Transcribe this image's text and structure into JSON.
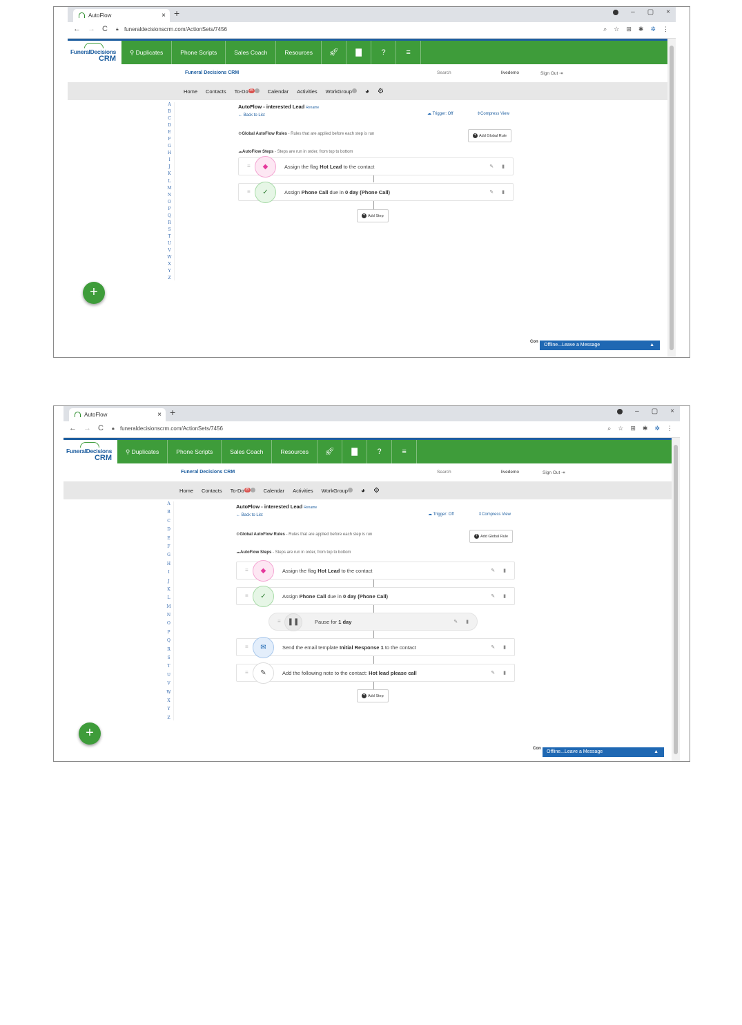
{
  "browser": {
    "tab_title": "AutoFlow",
    "tab_close": "×",
    "new_tab": "+",
    "url": "funeraldecisionscrm.com/ActionSets/7456",
    "back": "←",
    "forward": "→",
    "reload": "C",
    "minimize": "–",
    "restore": "▢",
    "close": "×"
  },
  "logo": {
    "top": "FuneralDecisions",
    "crm": "CRM"
  },
  "main_nav": {
    "duplicates": "Duplicates",
    "phone_scripts": "Phone Scripts",
    "sales_coach": "Sales Coach",
    "resources": "Resources"
  },
  "crm_bar": {
    "title": "Funeral Decisions CRM",
    "search": "Search",
    "user": "livedemo",
    "sign_out": "Sign Out"
  },
  "sub_nav": {
    "home": "Home",
    "contacts": "Contacts",
    "todo": "To-Do",
    "todo_badge": "35",
    "calendar": "Calendar",
    "activities": "Activities",
    "workgroup": "WorkGroup"
  },
  "alphabet": [
    "A",
    "B",
    "C",
    "D",
    "E",
    "F",
    "G",
    "H",
    "I",
    "J",
    "K",
    "L",
    "M",
    "N",
    "O",
    "P",
    "Q",
    "R",
    "S",
    "T",
    "U",
    "V",
    "W",
    "X",
    "Y",
    "Z"
  ],
  "fab": "+",
  "autoflow": {
    "title": "AutoFlow - interested Lead",
    "rename": "Rename",
    "back_to_list": "Back to List",
    "trigger": "Trigger: Off",
    "compress": "Compress View",
    "global_rules_label": "Global AutoFlow Rules",
    "global_rules_desc": " - Rules that are applied before each step is run",
    "add_global_rule": "Add Global Rule",
    "steps_label": "AutoFlow Steps",
    "steps_desc": " - Steps are run in order, from top to bottom",
    "add_step": "Add Step"
  },
  "steps_first": [
    {
      "pre": "Assign the flag ",
      "bold": "Hot Lead",
      "post": " to the contact"
    },
    {
      "pre": "Assign ",
      "bold": "Phone Call",
      "post": " due in ",
      "bold2": "0 day (Phone Call)"
    }
  ],
  "steps_second": [
    {
      "pre": "Assign the flag ",
      "bold": "Hot Lead",
      "post": " to the contact"
    },
    {
      "pre": "Assign ",
      "bold": "Phone Call",
      "post": " due in ",
      "bold2": "0 day (Phone Call)"
    },
    {
      "pre": "Pause for ",
      "bold": "1 day"
    },
    {
      "pre": "Send the email template ",
      "bold": "Initial Response 1",
      "post": " to the contact"
    },
    {
      "pre": "Add the following note to the contact: ",
      "bold": "Hot lead please call"
    }
  ],
  "chat": {
    "label": "Offline...Leave a Message",
    "connector": "Con"
  },
  "colors": {
    "green": "#3e9c3a",
    "blue": "#1f5fa0",
    "chat_blue": "#1f68b3",
    "pink": "#e5399c",
    "check": "#2e7d32",
    "mail": "#1f68b3"
  }
}
